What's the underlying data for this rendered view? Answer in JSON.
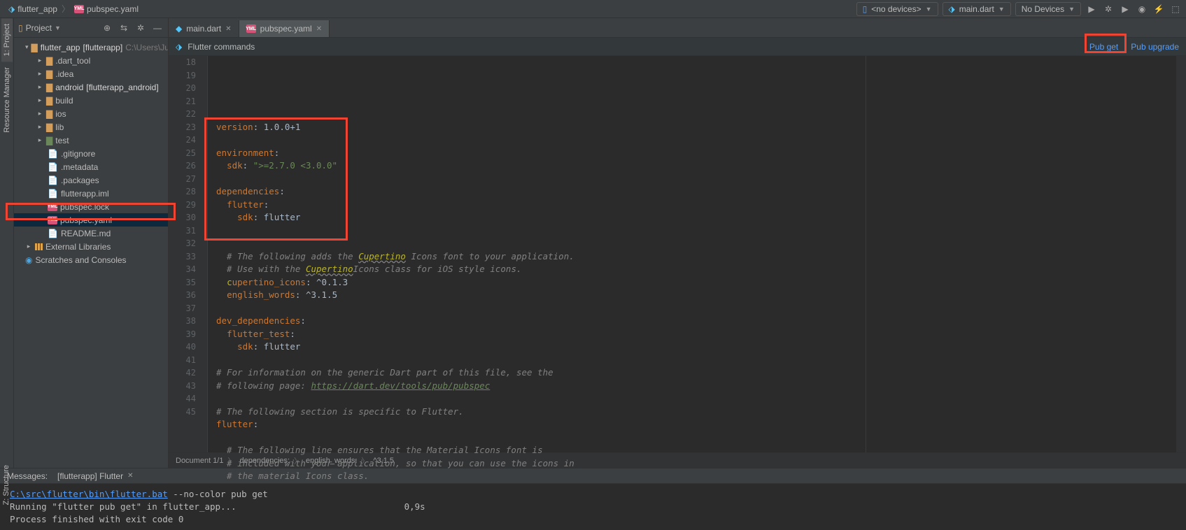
{
  "breadcrumb": {
    "project": "flutter_app",
    "file": "pubspec.yaml"
  },
  "top_controls": {
    "device": "<no devices>",
    "config": "main.dart",
    "devices_dropdown": "No Devices"
  },
  "project_panel": {
    "title": "Project",
    "root": "flutter_app",
    "root_suffix": "[flutterapp]",
    "root_path": "C:\\Users\\Juli...",
    "items": [
      ".dart_tool",
      ".idea",
      "android",
      "build",
      "ios",
      "lib",
      "test",
      ".gitignore",
      ".metadata",
      ".packages",
      "flutterapp.iml",
      "pubspec.lock",
      "pubspec.yaml",
      "README.md"
    ],
    "android_suffix": "[flutterapp_android]",
    "external_libs": "External Libraries",
    "scratches": "Scratches and Consoles"
  },
  "tabs": {
    "tab1": "main.dart",
    "tab2": "pubspec.yaml"
  },
  "flutter_bar": {
    "label": "Flutter commands",
    "pub_get": "Pub get",
    "pub_upgrade": "Pub upgrade"
  },
  "editor": {
    "line_start": 18,
    "lines": [
      "version: 1.0.0+1",
      "",
      "environment:",
      "  sdk: \">=2.7.0 <3.0.0\"",
      "",
      "dependencies:",
      "  flutter:",
      "    sdk: flutter",
      "",
      "",
      "  # The following adds the Cupertino Icons font to your application.",
      "  # Use with the CupertinoIcons class for iOS style icons.",
      "  cupertino_icons: ^0.1.3",
      "  english_words: ^3.1.5",
      "",
      "dev_dependencies:",
      "  flutter_test:",
      "    sdk: flutter",
      "",
      "# For information on the generic Dart part of this file, see the",
      "# following page: https://dart.dev/tools/pub/pubspec",
      "",
      "# The following section is specific to Flutter.",
      "flutter:",
      "",
      "  # The following line ensures that the Material Icons font is",
      "  # included with your application, so that you can use the icons in",
      "  # the material Icons class."
    ]
  },
  "bottom_breadcrumb": {
    "doc": "Document 1/1",
    "b1": "dependencies:",
    "b2": "english_words:",
    "b3": "^3.1.5"
  },
  "messages": {
    "label": "Messages:",
    "tab": "[flutterapp] Flutter"
  },
  "terminal": {
    "path": "C:\\src\\flutter\\bin\\flutter.bat",
    "args": " --no-color pub get",
    "line2a": "Running \"flutter pub get\" in flutter_app...",
    "line2b": "0,9s",
    "line3": "Process finished with exit code 0"
  }
}
